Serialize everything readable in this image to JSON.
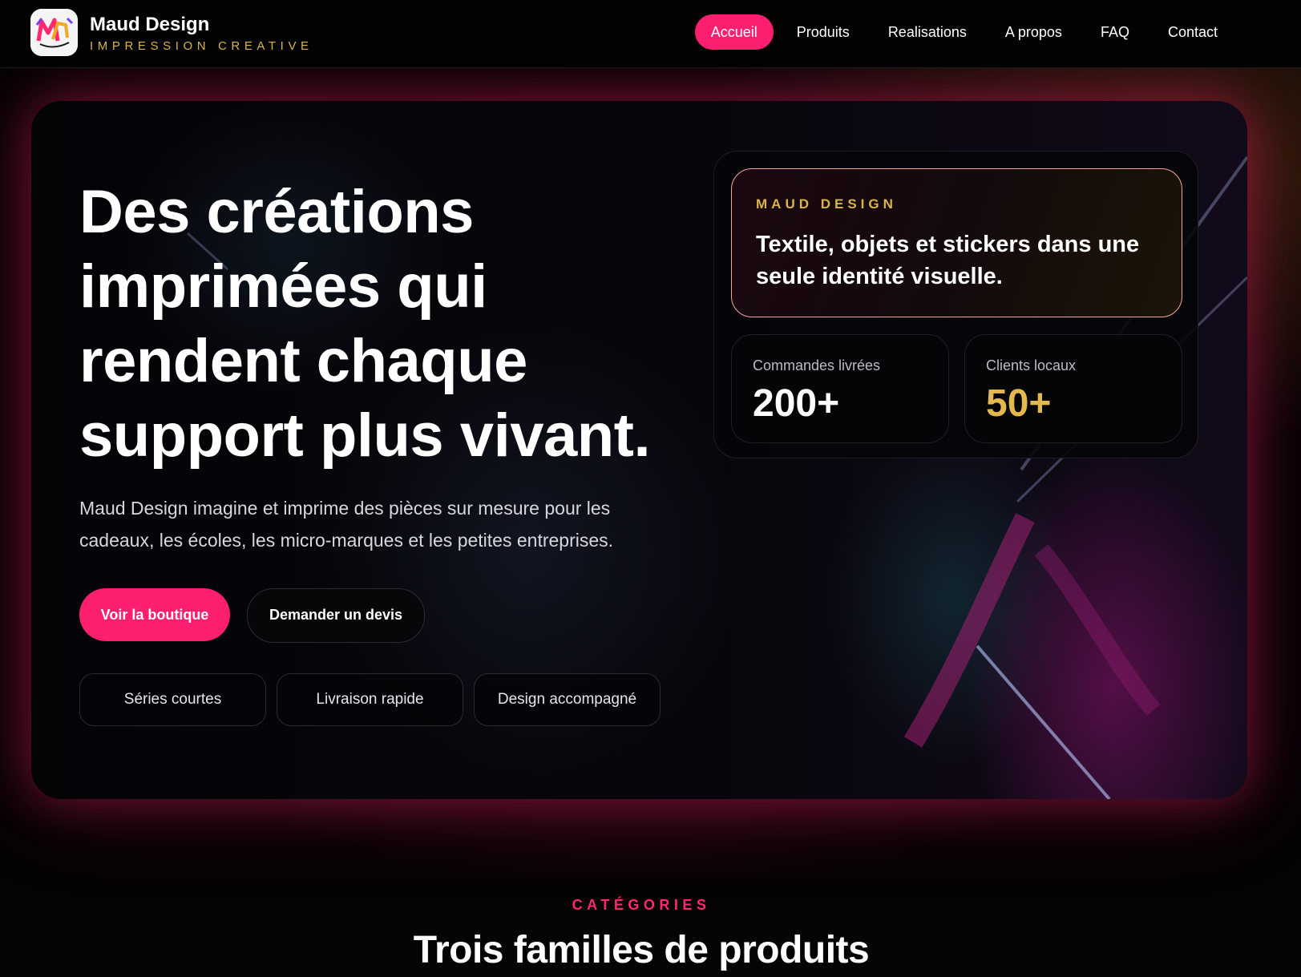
{
  "header": {
    "brand_name": "Maud Design",
    "brand_tagline": "IMPRESSION CREATIVE",
    "logo_icon": "maud-design-logo",
    "nav": [
      {
        "label": "Accueil",
        "active": true
      },
      {
        "label": "Produits"
      },
      {
        "label": "Realisations"
      },
      {
        "label": "A propos"
      },
      {
        "label": "FAQ"
      },
      {
        "label": "Contact"
      }
    ]
  },
  "hero": {
    "title": "Des créations imprimées qui rendent chaque support plus vivant.",
    "description": "Maud Design imagine et imprime des pièces sur mesure pour les cadeaux, les écoles, les micro-marques et les petites entreprises.",
    "primary_button": "Voir la boutique",
    "secondary_button": "Demander un devis",
    "chips": [
      "Séries courtes",
      "Livraison rapide",
      "Design accompagné"
    ]
  },
  "panel": {
    "kicker": "MAUD DESIGN",
    "text": "Textile, objets et stickers dans une seule identité visuelle.",
    "stats": [
      {
        "label": "Commandes livrées",
        "value": "200+"
      },
      {
        "label": "Clients locaux",
        "value": "50+"
      }
    ]
  },
  "categories": {
    "kicker": "CATÉGORIES",
    "title": "Trois familles de produits"
  },
  "colors": {
    "accent": "#ff1f70",
    "gold": "#d9b44a",
    "background": "#050305"
  }
}
